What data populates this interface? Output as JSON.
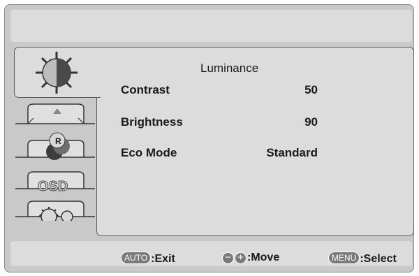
{
  "menu": {
    "section_title": "Luminance",
    "items": [
      {
        "label": "Contrast",
        "value": "50"
      },
      {
        "label": "Brightness",
        "value": "90"
      },
      {
        "label": "Eco Mode",
        "value": "Standard"
      }
    ]
  },
  "tabs": [
    {
      "icon": "luminance-icon"
    },
    {
      "icon": "image-setup-icon"
    },
    {
      "icon": "color-temp-icon"
    },
    {
      "icon": "osd-setup-icon"
    },
    {
      "icon": "extra-settings-icon"
    }
  ],
  "hints": {
    "auto_key": "AUTO",
    "auto_action": ":Exit",
    "minus_key": "−",
    "plus_key": "+",
    "move_action": ":Move",
    "menu_key": "MENU",
    "menu_action": ":Select"
  }
}
